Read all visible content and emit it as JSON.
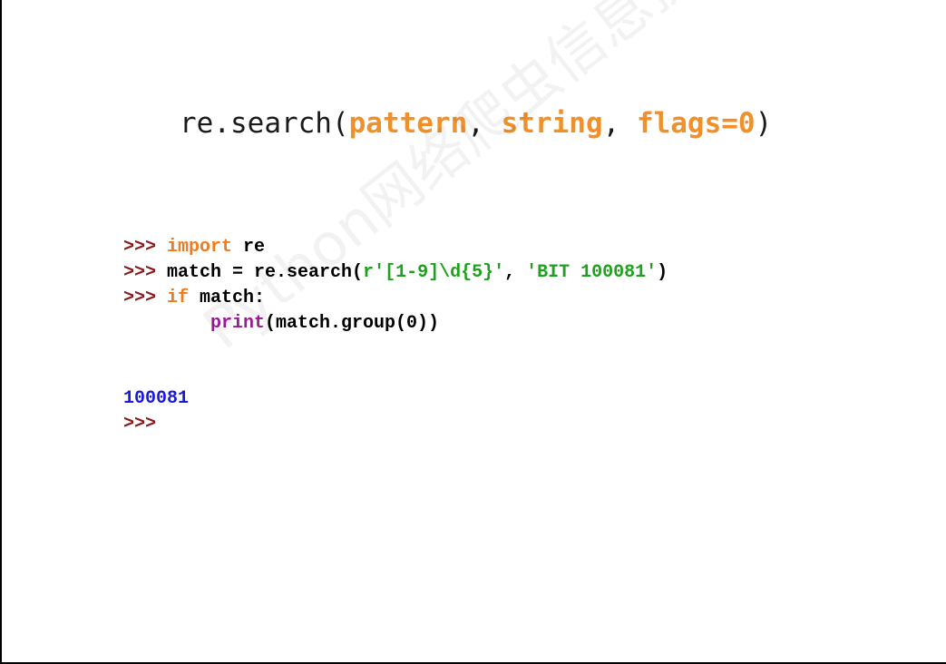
{
  "signature": {
    "func": "re.search(",
    "p1": "pattern",
    "sep1": ", ",
    "p2": "string",
    "sep2": ", ",
    "p3": "flags=0",
    "close": ")"
  },
  "code": {
    "prompt": ">>>",
    "line1_kw": "import",
    "line1_rest": " re",
    "line2_a": " match = re.search(",
    "line2_str1": "r'[1-9]\\d{5}'",
    "line2_sep": ", ",
    "line2_str2": "'BIT 100081'",
    "line2_close": ")",
    "line3_kw": "if",
    "line3_rest": " match:",
    "line4_indent": "        ",
    "line4_builtin": "print",
    "line4_rest": "(match.group(0))"
  },
  "output": {
    "value": "100081",
    "prompt": ">>>"
  },
  "watermark": "Python网络爬虫信息提取",
  "colors": {
    "param": "#f0902a",
    "prompt": "#8b1a1a",
    "keyword": "#f07a1e",
    "string": "#1fa01f",
    "builtin": "#9a1a9a",
    "output": "#1a1ae0"
  }
}
